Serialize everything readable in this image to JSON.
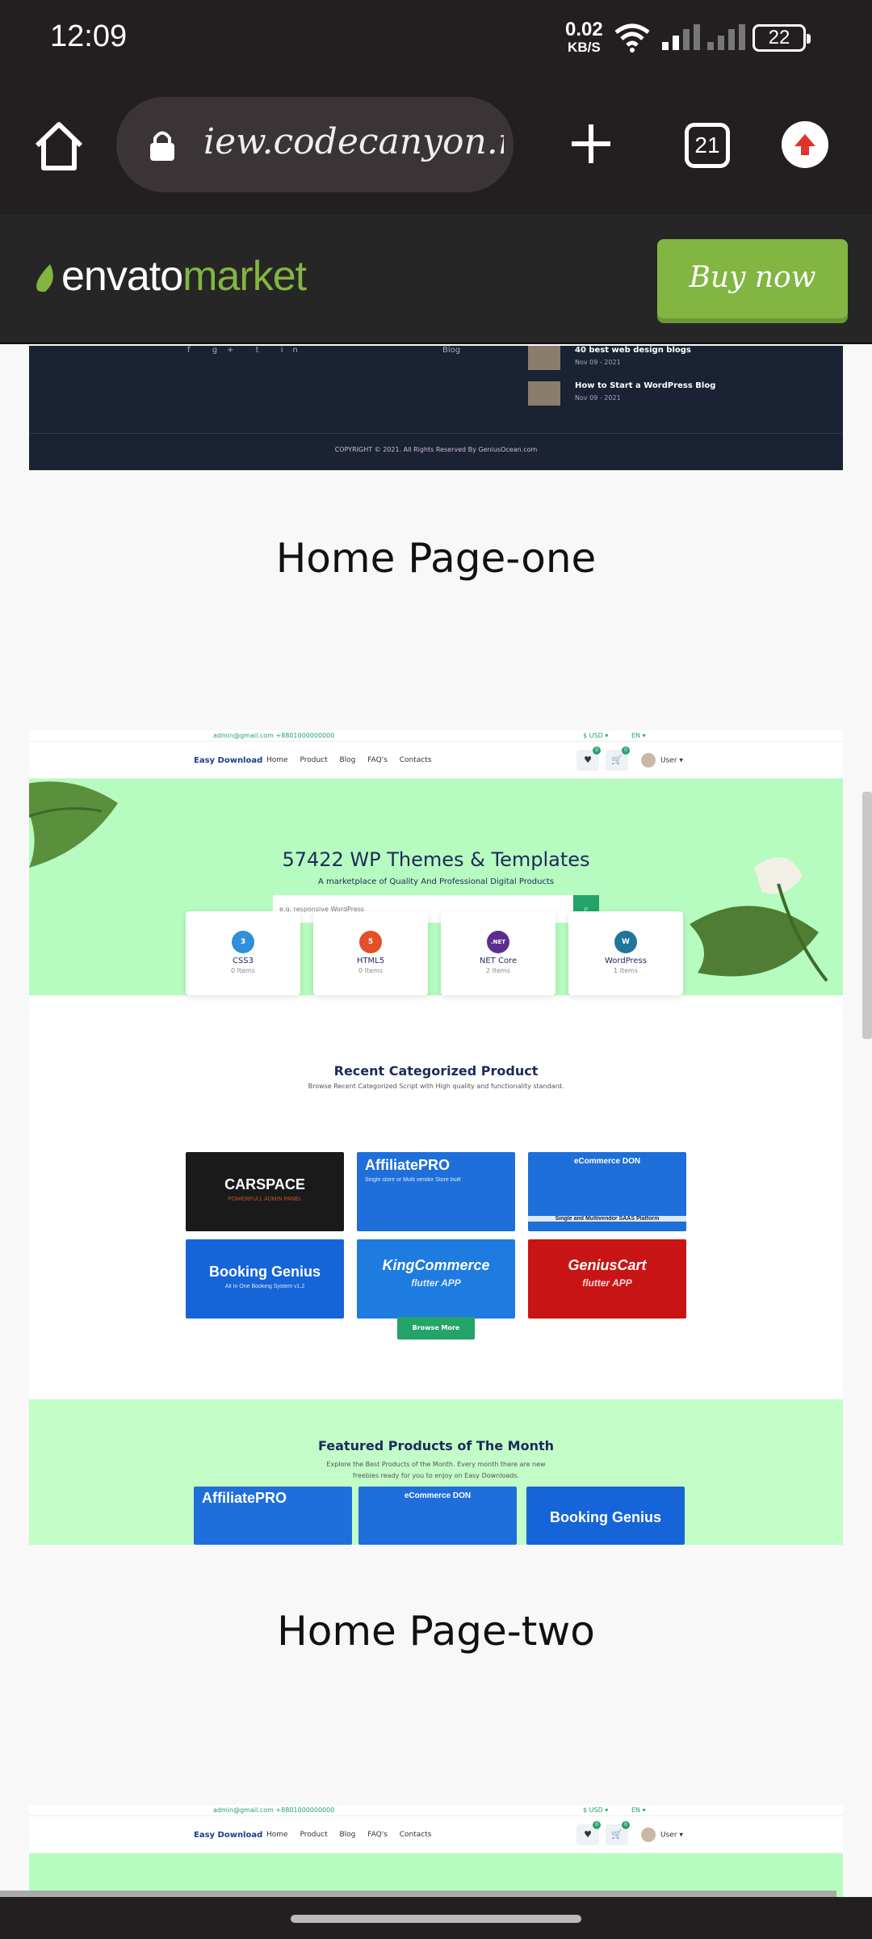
{
  "status": {
    "time": "12:09",
    "speed_value": "0.02",
    "speed_unit": "KB/S",
    "battery": "22"
  },
  "browser": {
    "url": "iew.codecanyon.net",
    "tab_count": "21"
  },
  "envato": {
    "logo_brand": "envato",
    "logo_product": "market",
    "buy_label": "Buy now"
  },
  "footer": {
    "social_icons": "f g+ t in",
    "blog_link": "Blog",
    "posts": [
      {
        "title": "40 best web design blogs",
        "date": "Nov 09 - 2021"
      },
      {
        "title": "How to Start a WordPress Blog",
        "date": "Nov 09 - 2021"
      }
    ],
    "copyright": "COPYRIGHT © 2021. All Rights Reserved By GeniusOcean.com"
  },
  "sections": {
    "home_one": "Home Page-one",
    "home_two": "Home Page-two"
  },
  "site": {
    "contact": "admin@gmail.com   +8801000000000",
    "currency": "$  USD ▾",
    "language": "EN ▾",
    "brand": "Easy Download",
    "nav": [
      "Home",
      "Product",
      "Blog",
      "FAQ's",
      "Contacts"
    ],
    "wishlist_count": "0",
    "cart_count": "0",
    "user_label": "User ▾",
    "hero_title": "57422 WP Themes & Templates",
    "hero_subtitle": "A marketplace of Quality And Professional Digital Products",
    "search_placeholder": "e.g. responsive WordPress",
    "categories": [
      {
        "name": "CSS3",
        "count": "0 Items",
        "icon": "css3-icon",
        "color": "#2f8fd8",
        "glyph": "3"
      },
      {
        "name": "HTML5",
        "count": "0 Items",
        "icon": "html5-icon",
        "color": "#e34f26",
        "glyph": "5"
      },
      {
        "name": "NET Core",
        "count": "2 Items",
        "icon": "dotnet-icon",
        "color": "#5c2d91",
        "glyph": ".NET"
      },
      {
        "name": "WordPress",
        "count": "1 Items",
        "icon": "wordpress-icon",
        "color": "#21759b",
        "glyph": "W"
      }
    ],
    "recent_title": "Recent Categorized Product",
    "recent_subtitle": "Browse Recent Categorized Script with High quality and functionality standard.",
    "products": [
      {
        "title": "CARSPACE",
        "sub": "POWERFULL ADMIN PANEL",
        "bg": "#1a1a1a"
      },
      {
        "title": "AffiliatePRO",
        "sub": "Single store or Multi vendor Store built",
        "bg": "#1e6fd9"
      },
      {
        "title": "eCommerce DON",
        "sub": "Single and Multivendor SAAS Platform",
        "bg": "#1e6fd9"
      },
      {
        "title": "Booking Genius",
        "sub": "All In One Booking System  v1.2",
        "bg": "#1565d8"
      },
      {
        "title": "KingCommerce",
        "sub": "flutter APP",
        "bg": "#1e7be0"
      },
      {
        "title": "GeniusCart",
        "sub": "flutter APP",
        "bg": "#c81414"
      }
    ],
    "browse_label": "Browse More",
    "featured_title": "Featured Products of The Month",
    "featured_subtitle": "Explore the Best Products of the Month. Every month there are new freebies ready for you to enjoy on Easy Downloads.",
    "featured_products": [
      {
        "title": "AffiliatePRO",
        "bg": "#1e6fd9"
      },
      {
        "title": "eCommerce DON",
        "bg": "#1e6fd9"
      },
      {
        "title": "Booking Genius",
        "bg": "#1565d8"
      }
    ]
  }
}
